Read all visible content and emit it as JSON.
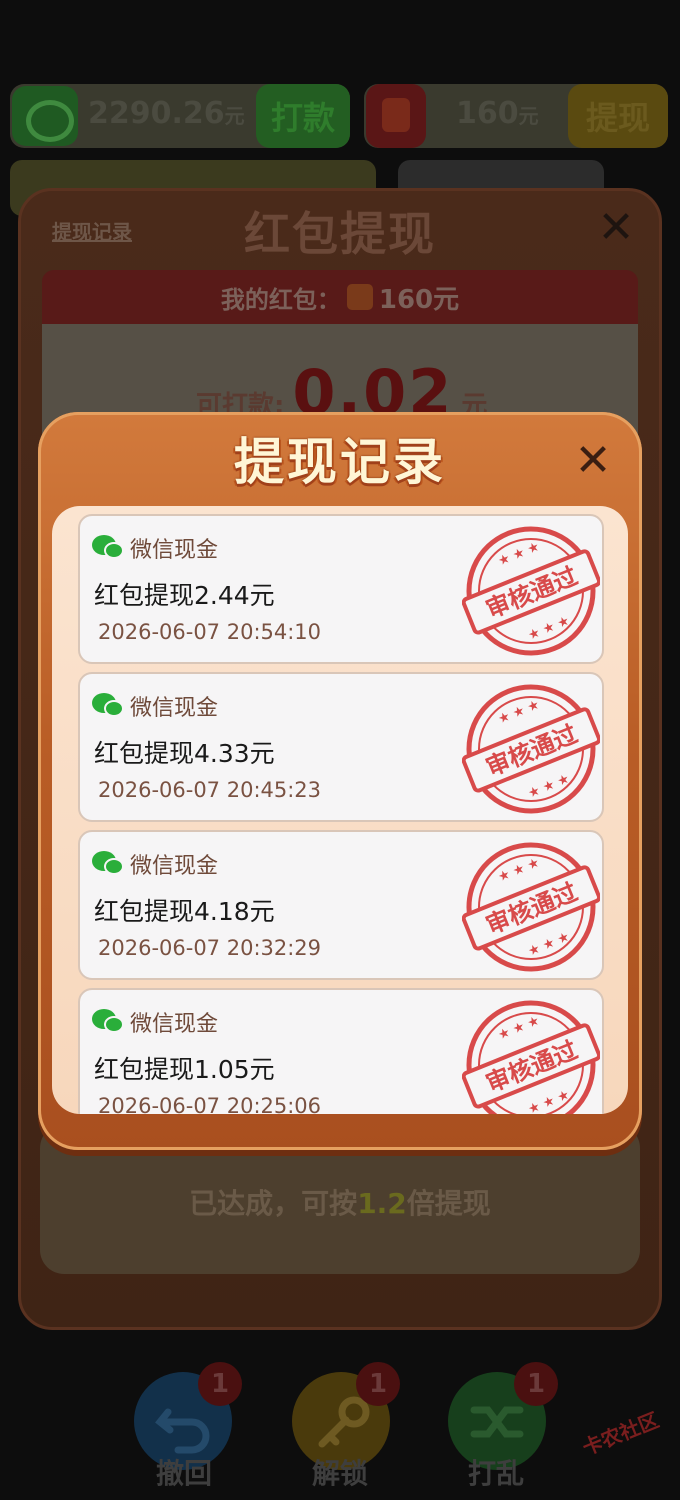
{
  "topbar": {
    "wechat_balance": "2290.26",
    "wechat_unit": "元",
    "pay_button": "打款",
    "redpacket_balance": "160",
    "redpacket_unit": "元",
    "withdraw_button": "提现"
  },
  "main_panel": {
    "title": "红包提现",
    "record_link": "提现记录",
    "my_redpacket_label": "我的红包：",
    "my_redpacket_amount": "160元",
    "payable_label": "可打款:",
    "payable_amount": "0.02",
    "payable_unit": "元",
    "achieved_prefix": "已达成，可按",
    "achieved_multiplier": "1.2",
    "achieved_suffix": "倍提现"
  },
  "modal": {
    "title": "提现记录",
    "records": [
      {
        "source": "微信现金",
        "title": "红包提现2.44元",
        "time": "2026-06-07 20:54:10",
        "status": "审核通过"
      },
      {
        "source": "微信现金",
        "title": "红包提现4.33元",
        "time": "2026-06-07 20:45:23",
        "status": "审核通过"
      },
      {
        "source": "微信现金",
        "title": "红包提现4.18元",
        "time": "2026-06-07 20:32:29",
        "status": "审核通过"
      },
      {
        "source": "微信现金",
        "title": "红包提现1.05元",
        "time": "2026-06-07 20:25:06",
        "status": "审核通过"
      }
    ]
  },
  "tools": [
    {
      "label": "撤回",
      "count": "1",
      "icon": "undo-icon"
    },
    {
      "label": "解锁",
      "count": "1",
      "icon": "key-icon"
    },
    {
      "label": "打乱",
      "count": "1",
      "icon": "shuffle-icon"
    }
  ],
  "watermark": "卡农社区",
  "colors": {
    "stamp_red": "#d84a4a",
    "wechat_green": "#2aae3a",
    "modal_orange": "#c0622a"
  }
}
